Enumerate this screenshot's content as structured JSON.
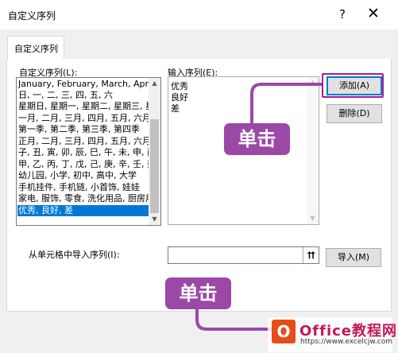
{
  "dialog": {
    "title": "自定义序列",
    "help": "?",
    "close": "✕"
  },
  "tab": {
    "label": "自定义序列"
  },
  "custom_lists": {
    "label": "自定义序列(L):",
    "items": [
      "January, February, March, April",
      "日, 一, 二, 三, 四, 五, 六",
      "星期日, 星期一, 星期二, 星期三, 星",
      "一月, 二月, 三月, 四月, 五月, 六月,",
      "第一季, 第二季, 第三季, 第四季",
      "正月, 二月, 三月, 四月, 五月, 六月,",
      "子, 丑, 寅, 卯, 辰, 巳, 午, 未, 申, 酉",
      "甲, 乙, 丙, 丁, 戊, 己, 庚, 辛, 壬, 癸",
      "幼儿园, 小学, 初中, 高中, 大学",
      "手机挂件, 手机链, 小首饰, 娃娃",
      "家电, 服饰, 零食, 洗化用品, 厨房用",
      "优秀, 良好, 差"
    ],
    "selected_index": 11
  },
  "list_entries": {
    "label": "输入序列(E):",
    "lines": [
      "优秀",
      "良好",
      "差"
    ]
  },
  "buttons": {
    "add": "添加(A)",
    "delete": "删除(D)",
    "import": "导入(M)"
  },
  "import": {
    "label": "从单元格中导入序列(I):",
    "value": "",
    "picker_icon": "range-picker-icon"
  },
  "annotations": {
    "callout_1": "单击",
    "callout_2": "单击",
    "color": "#9b48a7"
  },
  "watermark": {
    "logo_letter": "O",
    "brand": "Office教程网",
    "site": "https://www.excelcjw.com"
  }
}
